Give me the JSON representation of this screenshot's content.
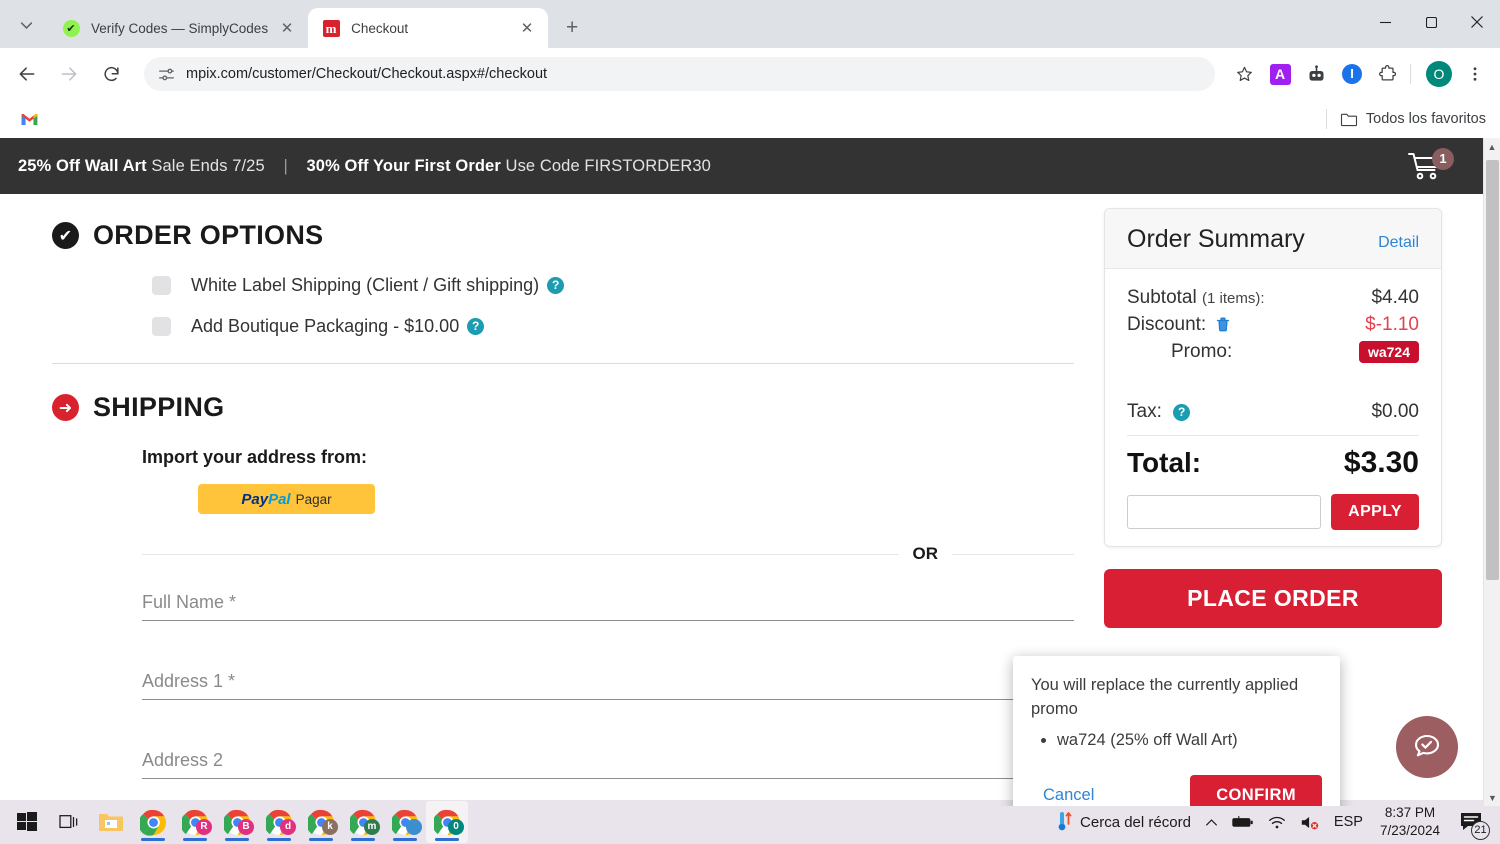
{
  "browser": {
    "tabs": [
      {
        "title": "Verify Codes — SimplyCodes",
        "favicon": "simplycodes-icon",
        "active": false
      },
      {
        "title": "Checkout",
        "favicon": "mpix-icon",
        "active": true
      }
    ],
    "new_tab_label": "+",
    "nav": {
      "back": "←",
      "forward": "→",
      "reload": "⟳"
    },
    "omnibox": {
      "url": "mpix.com/customer/Checkout/Checkout.aspx#/checkout",
      "site_info_icon": "site-settings-icon"
    },
    "toolbar_icons": {
      "bookmark_star": "☆",
      "ext_a_label": "A",
      "ext_bot_label": "robot-icon",
      "ext_i_label": "I",
      "ext_puzzle_label": "puzzle-icon",
      "profile_label": "O",
      "menu_label": "⋮"
    },
    "window_controls": {
      "minimize": "—",
      "maximize": "▢",
      "close": "✕"
    },
    "bookmarks_bar": {
      "items": [
        {
          "label": "",
          "icon": "gmail-icon"
        }
      ],
      "all_bookmarks_label": "Todos los favoritos"
    }
  },
  "page": {
    "promo_banner": {
      "deal1_bold": "25% Off Wall Art",
      "deal1_rest": "Sale Ends 7/25",
      "separator": "|",
      "deal2_bold": "30% Off Your First Order",
      "deal2_rest": "Use Code FIRSTORDER30",
      "cart_count": "1",
      "cart_icon": "shopping-cart-icon"
    },
    "order_options": {
      "title": "ORDER OPTIONS",
      "icon": "check-circle-icon",
      "options": [
        {
          "label": "White Label Shipping (Client / Gift shipping)",
          "checked": false,
          "help": "?"
        },
        {
          "label": "Add Boutique Packaging - $10.00",
          "checked": false,
          "help": "?"
        }
      ]
    },
    "shipping": {
      "title": "SHIPPING",
      "icon": "arrow-circle-right-icon",
      "import_label": "Import your address from:",
      "paypal_button": {
        "logo": "PayPal",
        "label": "Pagar"
      },
      "or_label": "OR",
      "fields": [
        {
          "placeholder": "Full Name *",
          "value": ""
        },
        {
          "placeholder": "Address 1 *",
          "value": ""
        },
        {
          "placeholder": "Address 2",
          "value": ""
        }
      ]
    },
    "order_summary": {
      "title": "Order Summary",
      "detail_link": "Detail",
      "subtotal_label": "Subtotal",
      "subtotal_items": "(1 items):",
      "subtotal_value": "$4.40",
      "discount_label": "Discount:",
      "discount_value": "$-1.10",
      "discount_delete_icon": "trash-icon",
      "promo_label": "Promo:",
      "promo_chip": "wa724",
      "tax_label": "Tax:",
      "tax_help": "?",
      "tax_value": "$0.00",
      "total_label": "Total:",
      "total_value": "$3.30",
      "promo_input_placeholder": "",
      "apply_button": "APPLY",
      "place_order_button": "PLACE ORDER"
    },
    "confirm_popover": {
      "message_line1": "You will replace the currently applied",
      "message_line2": "promo",
      "bullets": [
        "wa724 (25% off Wall Art)"
      ],
      "cancel_label": "Cancel",
      "confirm_label": "CONFIRM"
    },
    "chat_widget": {
      "icon": "chat-check-icon"
    }
  },
  "taskbar": {
    "start_label": "start-icon",
    "items": [
      {
        "name": "start-button",
        "icon": "windows-icon"
      },
      {
        "name": "task-view-button",
        "icon": "task-view-icon"
      },
      {
        "name": "file-explorer",
        "icon": "folder-icon"
      },
      {
        "name": "chrome-window",
        "icon": "chrome-icon",
        "badge": ""
      },
      {
        "name": "chrome-profile-r",
        "icon": "chrome-icon",
        "badge": "R",
        "badge_color": "#e0307e"
      },
      {
        "name": "chrome-profile-b",
        "icon": "chrome-icon",
        "badge": "B",
        "badge_color": "#e0307e"
      },
      {
        "name": "chrome-profile-d",
        "icon": "chrome-icon",
        "badge": "d",
        "badge_color": "#e0307e"
      },
      {
        "name": "chrome-profile-k",
        "icon": "chrome-icon",
        "badge": "k",
        "badge_color": "#8a7060"
      },
      {
        "name": "chrome-profile-m",
        "icon": "chrome-icon",
        "badge": "m",
        "badge_color": "#2f7d4f"
      },
      {
        "name": "chrome-profile-globe",
        "icon": "chrome-icon",
        "badge": "",
        "badge_color": "#3b8ed0"
      },
      {
        "name": "chrome-profile-o",
        "icon": "chrome-icon",
        "badge": "0",
        "badge_color": "#00897b"
      }
    ],
    "weather": "Cerca del récord",
    "weather_icon": "thermometer-icon",
    "tray_icons": [
      "chevron-up-icon",
      "battery-icon",
      "wifi-icon",
      "volume-muted-icon"
    ],
    "language": "ESP",
    "time": "8:37 PM",
    "date": "7/23/2024",
    "notification_count": "21",
    "notification_icon": "notification-icon"
  },
  "colors": {
    "brand_red": "#d81f33",
    "promo_chip_red": "#c8102e",
    "banner_dark": "#333333",
    "link_blue": "#2f84d4",
    "teal_help": "#1b9cb0",
    "paypal_yellow": "#ffc439"
  }
}
